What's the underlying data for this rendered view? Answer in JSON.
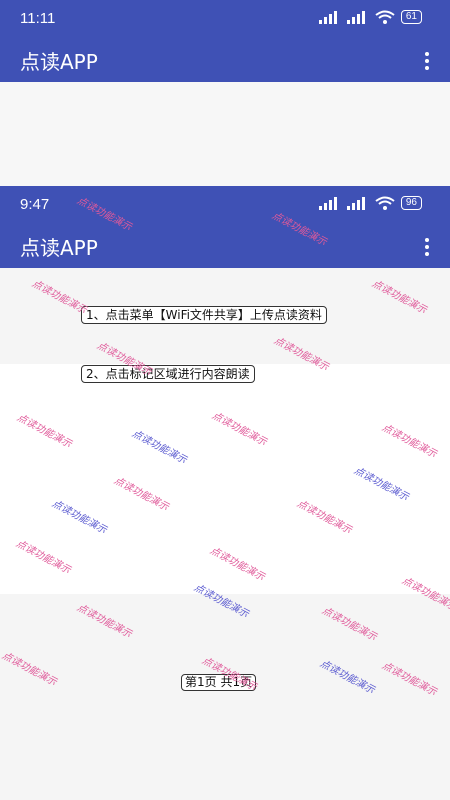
{
  "back_screen": {
    "status_time": "11:11",
    "battery": "61",
    "app_title": "点读APP"
  },
  "front_screen": {
    "status_time": "9:47",
    "battery": "96",
    "app_title": "点读APP",
    "instructions": [
      "1、点击菜单【WiFi文件共享】上传点读资料",
      "2、点击标记区域进行内容朗读"
    ],
    "pager": "第1页 共1页"
  },
  "watermark": "点读功能演示",
  "colors": {
    "appbar": "#3f51b5",
    "watermark_pink": "#e05a9a",
    "watermark_blue": "#5a5ad0"
  }
}
